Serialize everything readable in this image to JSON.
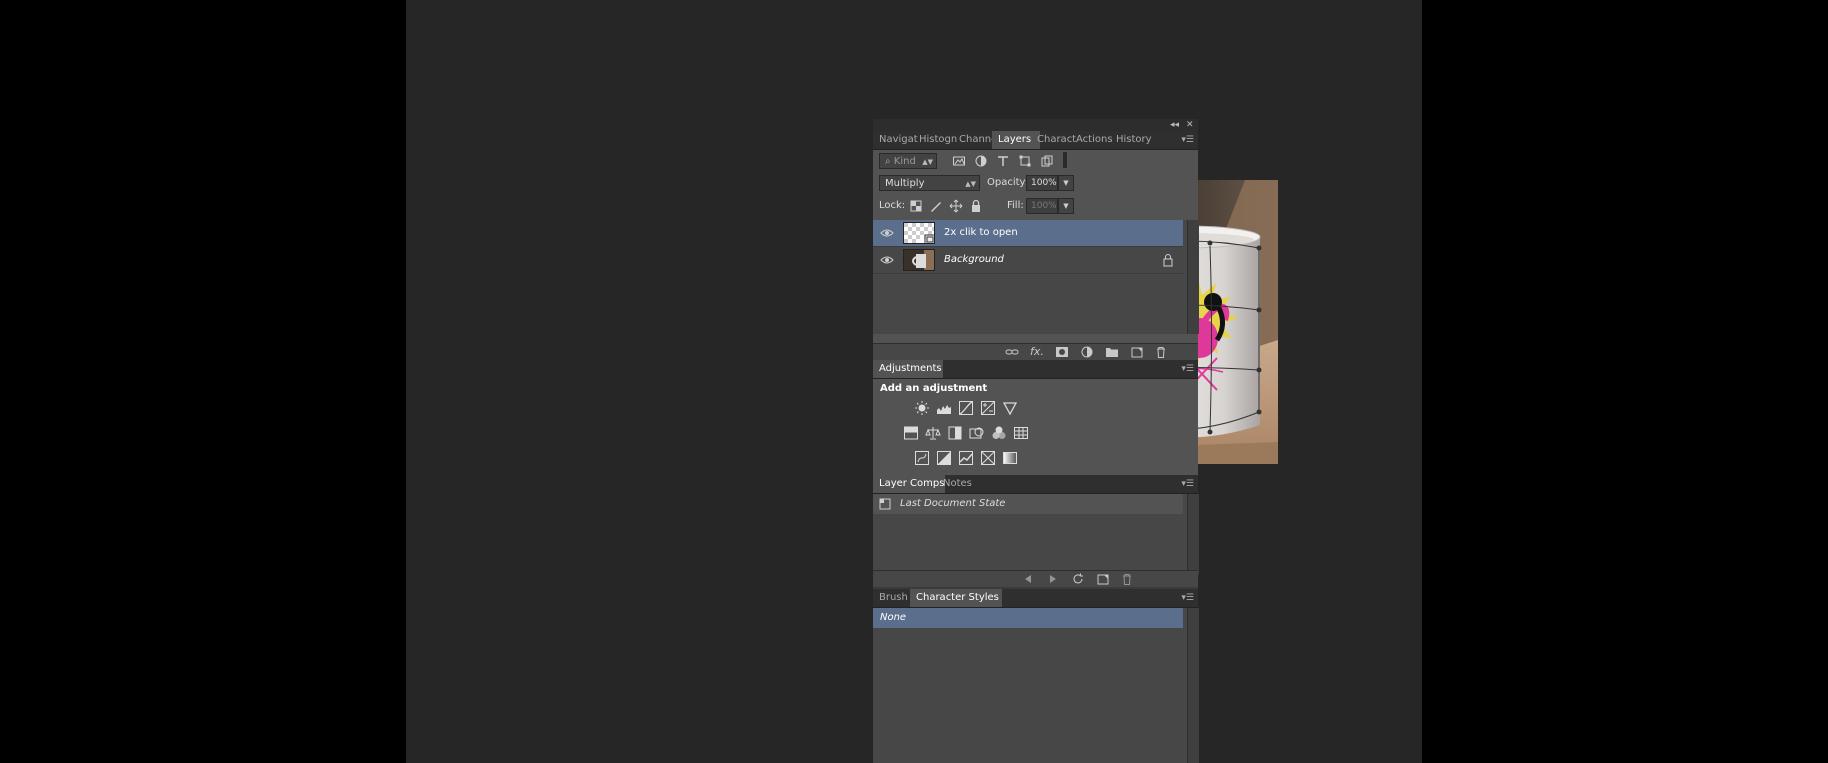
{
  "dock_controls": {
    "collapse": "◂◂",
    "close": "✕"
  },
  "top_panel": {
    "tabs": [
      "Navigat",
      "Histogn",
      "Channel",
      "Layers",
      "Charact",
      "Actions",
      "History"
    ],
    "active_tab": "Layers",
    "filter_kind": "Kind",
    "blend_mode": "Multiply",
    "opacity_label": "Opacity:",
    "opacity_value": "100%",
    "lock_label": "Lock:",
    "fill_label": "Fill:",
    "fill_value": "100%",
    "layers": [
      {
        "name": "2x clik to open",
        "selected": true,
        "italic": false,
        "locked": false
      },
      {
        "name": "Background",
        "selected": false,
        "italic": true,
        "locked": true
      }
    ]
  },
  "adjustments_panel": {
    "tab": "Adjustments",
    "title": "Add an adjustment"
  },
  "comps_panel": {
    "tabs": [
      "Layer Comps",
      "Notes"
    ],
    "active_tab": "Layer Comps",
    "rows": [
      "Last Document State"
    ]
  },
  "styles_panel": {
    "tabs": [
      "Brush",
      "Character Styles"
    ],
    "active_tab": "Character Styles",
    "rows": [
      "None"
    ]
  },
  "colors": {
    "workspace": "#262626",
    "panel": "#535353",
    "selection": "#5b6f8c",
    "flamingo_pink": "#e0389a",
    "sun_yellow": "#e8d43a"
  }
}
